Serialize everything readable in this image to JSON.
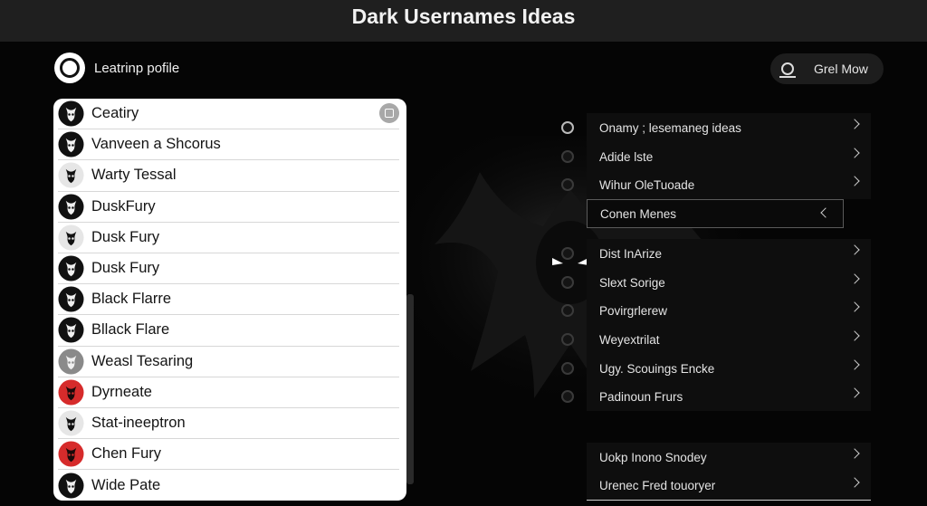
{
  "window": {
    "title": "Dark Usernames Ideas"
  },
  "profile": {
    "label": "Leatrinp pofile"
  },
  "header_button": {
    "label": "Grel Mow",
    "icon": "user-icon"
  },
  "usernames": [
    {
      "name": "Ceatiry",
      "avatar": "skull-icon",
      "tone": "dark"
    },
    {
      "name": "Vanveen a Shcorus",
      "avatar": "horned-mask-icon",
      "tone": "dark"
    },
    {
      "name": "Warty Tessal",
      "avatar": "hooded-figure-icon",
      "tone": "light"
    },
    {
      "name": "DuskFury",
      "avatar": "demon-face-icon",
      "tone": "dark"
    },
    {
      "name": "Dusk Fury",
      "avatar": "mask-icon",
      "tone": "light"
    },
    {
      "name": "Dusk Fury",
      "avatar": "silhouette-icon",
      "tone": "dark"
    },
    {
      "name": "Black Flarre",
      "avatar": "flame-face-icon",
      "tone": "dark"
    },
    {
      "name": "Bllack Flare",
      "avatar": "tribal-mask-icon",
      "tone": "dark"
    },
    {
      "name": "Weasl Tesaring",
      "avatar": "wolf-icon",
      "tone": "grey"
    },
    {
      "name": "Dyrneate",
      "avatar": "red-demon-icon",
      "tone": "red"
    },
    {
      "name": "Stat-ineeptron",
      "avatar": "horned-figure-icon",
      "tone": "light"
    },
    {
      "name": "Chen Fury",
      "avatar": "red-wolf-icon",
      "tone": "red"
    },
    {
      "name": "Wide Pate",
      "avatar": "ghost-skull-icon",
      "tone": "dark"
    }
  ],
  "menu": [
    {
      "label": "Onamy ; lesemaneg ideas"
    },
    {
      "label": "Adide lste"
    },
    {
      "label": "Wihur OleTuoade"
    },
    {
      "label": "Conen Menes"
    },
    {
      "label": "Dist InArize"
    },
    {
      "label": "Slext Sorige"
    },
    {
      "label": "Povirgrlerew"
    },
    {
      "label": "Weyextrilat"
    },
    {
      "label": "Ugy. Scouings Encke"
    },
    {
      "label": "Padinoun Frurs"
    },
    {
      "label": "Uokp Inono Snodey"
    },
    {
      "label": "Urenec Fred touoryer"
    }
  ],
  "colors": {
    "accent_red": "#d62b2b",
    "card_bg": "#ffffff",
    "page_bg": "#050505"
  }
}
